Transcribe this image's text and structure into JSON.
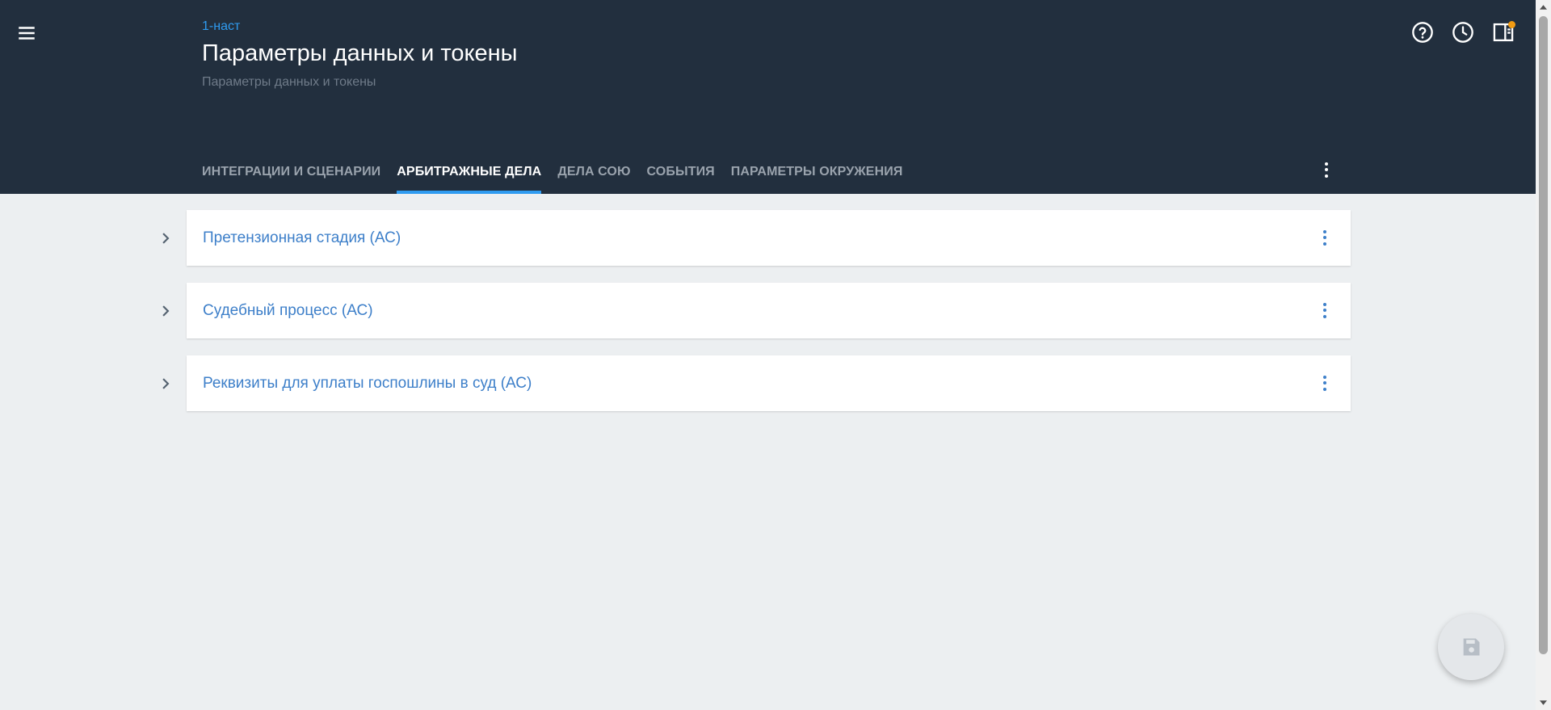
{
  "header": {
    "breadcrumb": "1-наст",
    "title": "Параметры данных и токены",
    "subtitle": "Параметры данных и токены",
    "icons": [
      "menu-icon",
      "help-icon",
      "history-icon",
      "panel-icon"
    ]
  },
  "tabs": [
    {
      "label": "ИНТЕГРАЦИИ И СЦЕНАРИИ",
      "active": false
    },
    {
      "label": "АРБИТРАЖНЫЕ ДЕЛА",
      "active": true
    },
    {
      "label": "ДЕЛА СОЮ",
      "active": false
    },
    {
      "label": "СОБЫТИЯ",
      "active": false
    },
    {
      "label": "ПАРАМЕТРЫ ОКРУЖЕНИЯ",
      "active": false
    }
  ],
  "panels": [
    {
      "title": "Претензионная стадия (АС)"
    },
    {
      "title": "Судебный процесс (АС)"
    },
    {
      "title": "Реквизиты для уплаты госпошлины в суд (АС)"
    }
  ],
  "colors": {
    "header_bg": "#222f3e",
    "accent": "#2f9bf0",
    "link": "#3d7fc9",
    "notification": "#f39c12",
    "page_bg": "#eceff1"
  },
  "fab": {
    "icon": "save-icon"
  }
}
